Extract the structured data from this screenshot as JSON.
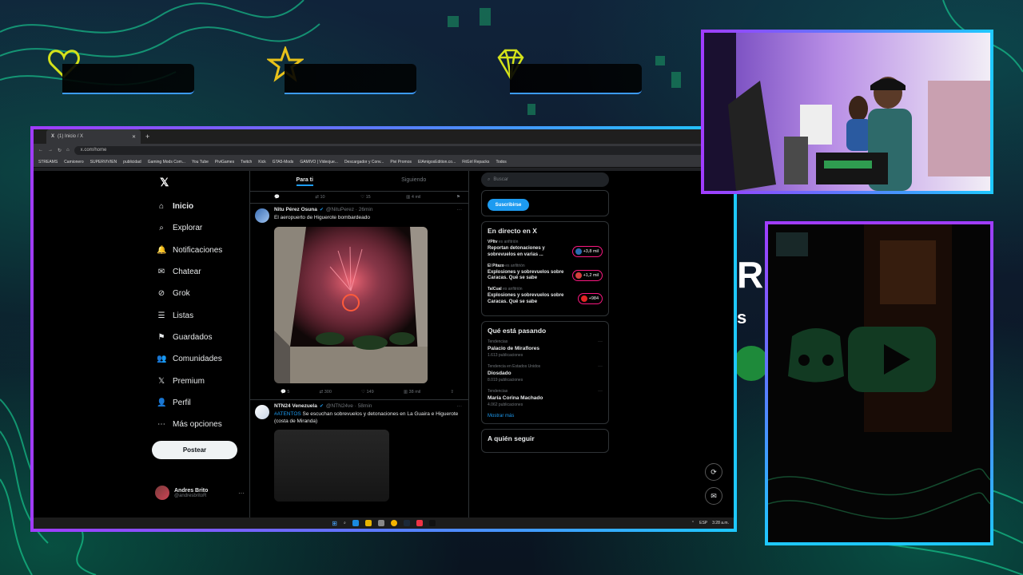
{
  "browser": {
    "tab_title": "(1) Inicio / X",
    "url": "x.com/home",
    "bookmarks": [
      "STREAMS",
      "Camionero",
      "SUPERVIVIEN",
      "publicidad",
      "Gaming Mods Com...",
      "You Tube",
      "PiviGames",
      "Twitch",
      "Kick",
      "GTA5-Mods",
      "GAMIVO | Videojue...",
      "Descargador y Conv...",
      "Pivi Promos",
      "ElAmigosEdition.co...",
      "FitGirl Repacks",
      "Todos"
    ]
  },
  "nav": {
    "items": [
      {
        "label": "Inicio",
        "icon": "home-icon"
      },
      {
        "label": "Explorar",
        "icon": "search-icon"
      },
      {
        "label": "Notificaciones",
        "icon": "bell-icon"
      },
      {
        "label": "Chatear",
        "icon": "mail-icon"
      },
      {
        "label": "Grok",
        "icon": "grok-icon"
      },
      {
        "label": "Listas",
        "icon": "list-icon"
      },
      {
        "label": "Guardados",
        "icon": "bookmark-icon"
      },
      {
        "label": "Comunidades",
        "icon": "communities-icon"
      },
      {
        "label": "Premium",
        "icon": "x-icon"
      },
      {
        "label": "Perfil",
        "icon": "person-icon"
      },
      {
        "label": "Más opciones",
        "icon": "more-icon"
      }
    ],
    "post_button": "Postear",
    "user": {
      "name": "Andres Brito",
      "handle": "@andresbritoR"
    }
  },
  "feed": {
    "tabs": [
      "Para ti",
      "Siguiendo"
    ],
    "top_row": {
      "retweets": "10",
      "likes": "15",
      "views": "4 mil"
    },
    "posts": [
      {
        "name": "Nitu Pérez Osuna",
        "handle": "@NituPerez · 26min",
        "text": "El aeropuerto de Higuerote bombardeado",
        "replies": "5",
        "retweets": "300",
        "likes": "149",
        "views": "38 mil"
      },
      {
        "name": "NTN24 Venezuela",
        "handle": "@NTN24ve · 58min",
        "hashtag": "#ATENTOS",
        "text": " Se escuchan sobrevuelos y detonaciones en La Guaira e Higuerote (costa de Miranda)"
      }
    ]
  },
  "right": {
    "search_placeholder": "Buscar",
    "subscribe": "Suscribirse",
    "live_title": "En directo en X",
    "live": [
      {
        "source": "VPItv",
        "role": "es anfitrión",
        "title": "Reportan detonaciones y sobrevuelos en varias ...",
        "count": "+3,8 mil",
        "color": "#2b6cb0"
      },
      {
        "source": "El Pitazo",
        "role": "es anfitrión",
        "title": "Explosiones y sobrevuelos sobre Caracas. Qué se sabe",
        "count": "+1,2 mil",
        "color": "#d53f3f"
      },
      {
        "source": "TalCual",
        "role": "es anfitrión",
        "title": "Explosiones y sobrevuelos sobre Caracas. Qué se sabe",
        "count": "+984",
        "color": "#e02424"
      }
    ],
    "trends_title": "Qué está pasando",
    "trends": [
      {
        "context": "Tendencias",
        "name": "Palacio de Miraflores",
        "count": "1.613 publicaciones"
      },
      {
        "context": "Tendencia en Estados Unidos",
        "name": "Diosdado",
        "count": "8.019 publicaciones"
      },
      {
        "context": "Tendencias",
        "name": "María Corina Machado",
        "count": "4.062 publicaciones"
      }
    ],
    "show_more": "Mostrar más",
    "who_follow": "A quién seguir"
  },
  "taskbar": {
    "lang": "ESP",
    "time": "3:28 a.m."
  },
  "colors": {
    "accent": "#1d9bf0",
    "frame_purple": "#a13cff",
    "frame_cyan": "#1ec9ff"
  }
}
